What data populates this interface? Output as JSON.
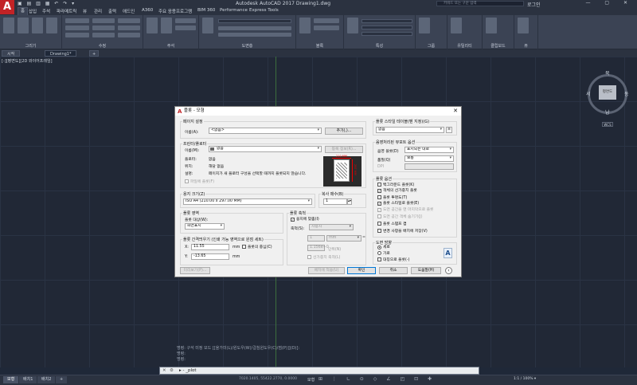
{
  "app": {
    "logo": "A",
    "title": "Autodesk AutoCAD 2017    Drawing1.dwg",
    "search_placeholder": "키워드 또는 구문 입력",
    "user": "로그인",
    "qat": "▣ ▤ ▥ ▦ ↶ ↷ ▾",
    "window_controls": "— ▢ ✕"
  },
  "menu_tabs": [
    "홈",
    "삽입",
    "주석",
    "파라메트릭",
    "뷰",
    "관리",
    "출력",
    "애드인",
    "A360",
    "주요 응용프로그램",
    "BIM 360",
    "Performance",
    "Express Tools"
  ],
  "ribbon_panels": [
    "그리기",
    "수정",
    "주석",
    "도면층",
    "블록",
    "특성",
    "그룹",
    "유틸리티",
    "클립보드",
    "뷰"
  ],
  "doc_tabs": [
    "시작",
    "Drawing1*"
  ],
  "viewport_label": "[-][평면도][2D 와이어프레임]",
  "viewcube": {
    "face": "평면도",
    "north": "북",
    "south": "남",
    "east": "동",
    "west": "서",
    "wcs": "WCS"
  },
  "command_history": [
    "명령: 구석 미정 모드 [[올가미(L)/윈도우(W)/걸침윈도우(C)/점(P)]](D)]:",
    "명령:",
    "명령:"
  ],
  "command_input": "▸ - _plot",
  "status": {
    "tabs": [
      "모형",
      "배치1",
      "배치2"
    ],
    "coords": "7020.1405, 55422.2770, 0.0000",
    "mode": "모형",
    "scale": "1:1 / 100% ▾"
  },
  "dialog": {
    "title": "플롯 - 모형",
    "page_setup": {
      "group": "페이지 설정",
      "name_label": "이름(A):",
      "name_value": "<없음>",
      "add_button": "추가(,)..."
    },
    "printer": {
      "group": "프린터/플로터",
      "name_label": "이름(M):",
      "name_value": "없음",
      "properties_button": "등록 정보(R)...",
      "plotter_label": "플로터:",
      "plotter_value": "없음",
      "where_label": "위치:",
      "where_value": "해당 없음",
      "desc_label": "설명:",
      "desc_value": "페이지가 새 플로터 구성을 선택할 때까지 플롯되지 않습니다.",
      "plot_to_file": "파일에 플롯(F)",
      "preview_width": "210 MM",
      "preview_height": "297 MM"
    },
    "paper_size": {
      "group": "용지 크기(Z)",
      "value": "ISO A4 (210.00 x 297.00 MM)"
    },
    "copies": {
      "group": "복사 매수(B)",
      "value": "1"
    },
    "plot_area": {
      "group": "플롯 영역",
      "what_label": "플롯 대상(W):",
      "what_value": "화면표시"
    },
    "plot_scale": {
      "group": "플롯 축척",
      "fit_to_paper": "용지에 맞춤(I)",
      "scale_label": "축척(S):",
      "scale_value": "사용자",
      "value1": "1",
      "unit": "mm",
      "unit_suffix": "=",
      "value2": "1.156e+0",
      "unit2": "단위(N)",
      "scale_lineweights": "선가중치 축척(L)"
    },
    "plot_offset": {
      "group": "플롯 간격띄우기 (인쇄 가능 영역으로 원점 세트)",
      "x_label": "X:",
      "x_value": "11.55",
      "x_unit": "mm",
      "y_label": "Y:",
      "y_value": "-13.65",
      "y_unit": "mm",
      "center_plot": "플롯의 중심(C)"
    },
    "plot_style": {
      "group": "플롯 스타일 테이블(펜 지정)(G)",
      "value": "없음"
    },
    "shaded_viewport": {
      "group": "음영처리된 뷰포트 옵션",
      "shade_label": "음영 플롯(D)",
      "shade_value": "표시되는 대로",
      "quality_label": "품질(Q)",
      "quality_value": "보통",
      "dpi_label": "DPI"
    },
    "plot_options": {
      "group": "플롯 옵션",
      "items": [
        {
          "label": "백그라운드 플롯(K)",
          "checked": false,
          "disabled": false
        },
        {
          "label": "객체의 선가중치 플롯",
          "checked": true,
          "disabled": false
        },
        {
          "label": "플롯 투명도(T)",
          "checked": false,
          "disabled": false
        },
        {
          "label": "플롯 스타일로 플롯(E)",
          "checked": true,
          "disabled": false
        },
        {
          "label": "도면 공간을 맨 마지막으로 플롯",
          "checked": true,
          "disabled": true
        },
        {
          "label": "도면 공간 객체 숨기기(J)",
          "checked": false,
          "disabled": true
        },
        {
          "label": "플롯 스탬프 켬",
          "checked": false,
          "disabled": false
        },
        {
          "label": "변경 사항을 배치에 저장(V)",
          "checked": false,
          "disabled": false
        }
      ]
    },
    "orientation": {
      "group": "도면 방향",
      "portrait": "세로",
      "landscape": "가로",
      "upside_down": "대칭으로 플롯(-)",
      "selected": "portrait",
      "icon": "A"
    },
    "buttons": {
      "preview_detail": "미리보기(P)...",
      "apply_layout": "배치에 적용(U)",
      "ok": "확인",
      "cancel": "취소",
      "help": "도움말(H)",
      "expand": "‹"
    }
  }
}
